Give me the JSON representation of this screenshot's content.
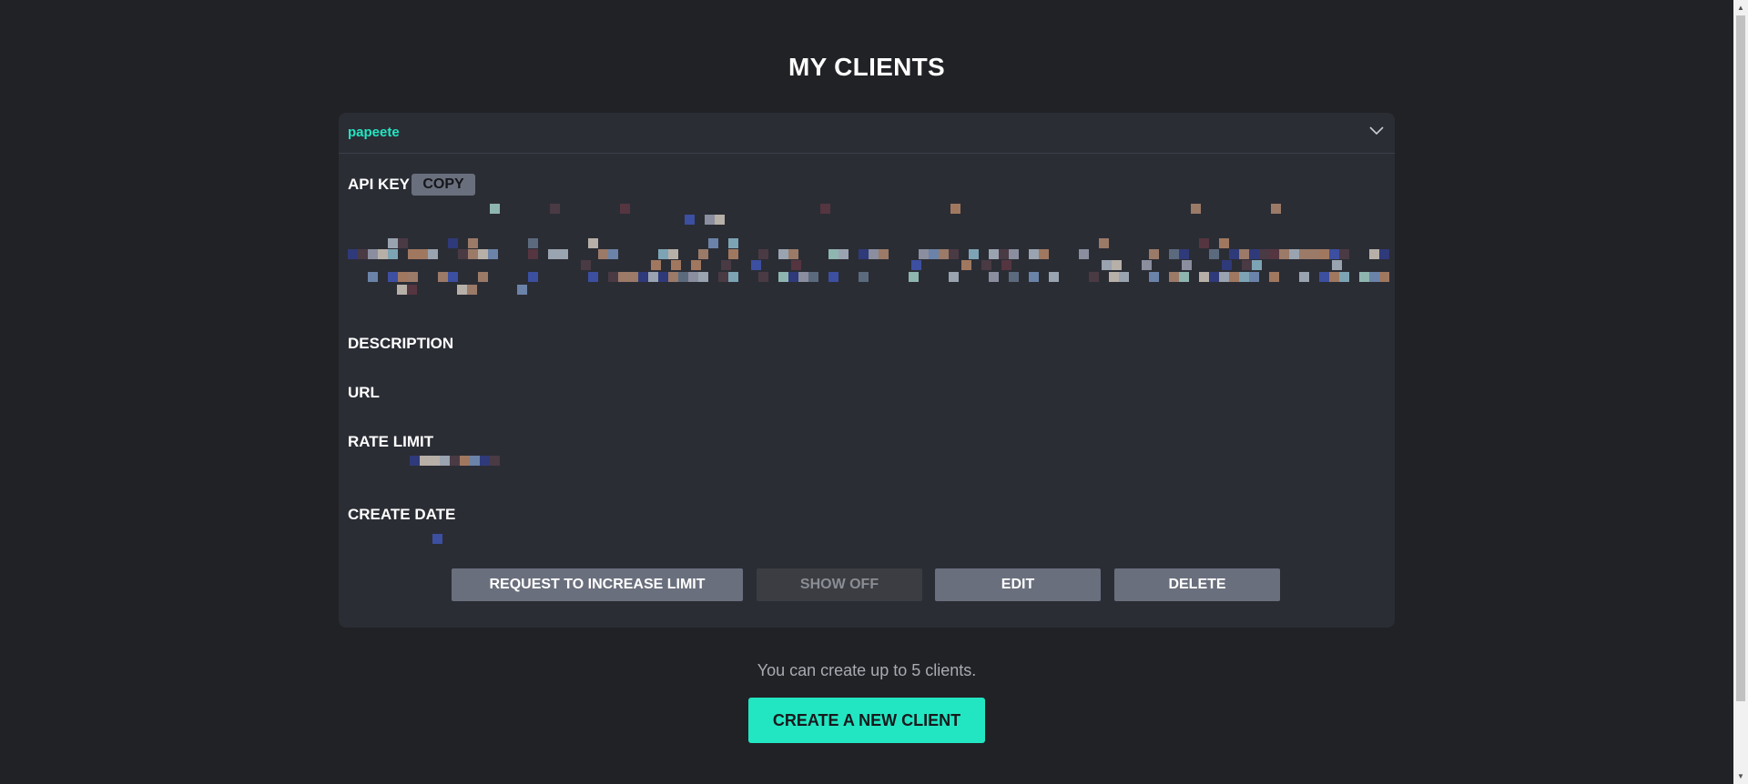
{
  "page": {
    "title": "MY CLIENTS"
  },
  "client": {
    "name": "papeete",
    "labels": {
      "api_key": "API KEY",
      "description": "DESCRIPTION",
      "url": "URL",
      "rate_limit": "RATE LIMIT",
      "create_date": "CREATE DATE"
    },
    "copy_label": "COPY",
    "icons": {
      "toggle": "chevron-down-icon"
    },
    "actions": {
      "request_increase": "REQUEST TO INCREASE LIMIT",
      "show_off": "SHOW OFF",
      "edit": "EDIT",
      "delete": "DELETE"
    }
  },
  "footer": {
    "limit_note": "You can create up to 5 clients.",
    "create_label": "CREATE A NEW CLIENT"
  },
  "colors": {
    "background": "#212226",
    "card": "#2b2d35",
    "accent": "#22e6c2",
    "button": "#6a6f7d",
    "button_disabled": "#3b3d43"
  }
}
